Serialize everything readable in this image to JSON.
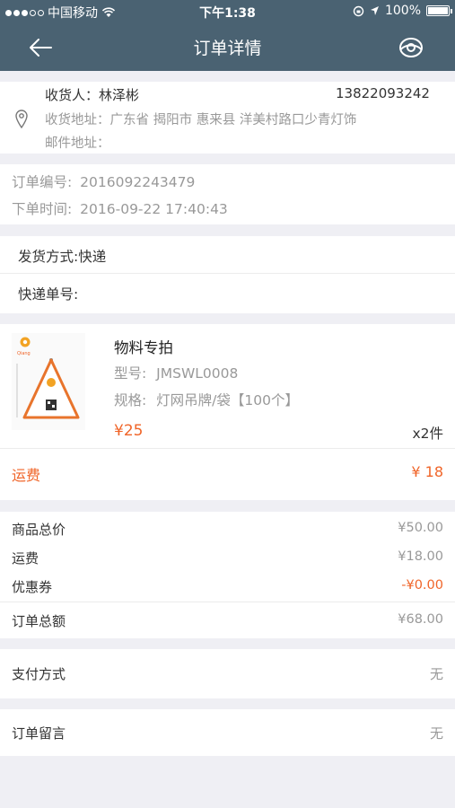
{
  "status_bar": {
    "carrier": "中国移动",
    "time": "下午1:38",
    "battery": "100%",
    "signal_filled": 3,
    "signal_total": 5
  },
  "nav": {
    "title": "订单详情",
    "back_icon": "arrow-left-icon",
    "right_icon": "eye-icon"
  },
  "address": {
    "receiver_label": "收货人：",
    "receiver_name": "林泽彬",
    "phone": "13822093242",
    "address_label": "收货地址：",
    "address_value": "广东省 揭阳市 惠来县  洋美村路口少青灯饰",
    "postal_label": "邮件地址：",
    "postal_value": ""
  },
  "order": {
    "number_label": "订单编号:",
    "number_value": "2016092243479",
    "time_label": "下单时间:",
    "time_value": "2016-09-22 17:40:43"
  },
  "shipping": {
    "method_label": "发货方式:",
    "method_value": "快递",
    "tracking_label": "快递单号:",
    "tracking_value": ""
  },
  "product": {
    "name": "物料专拍",
    "model_label": "型号:",
    "model_value": "JMSWL0008",
    "spec_label": "规格:",
    "spec_value": "灯网吊牌/袋【100个】",
    "price": "¥25",
    "quantity": "x2件",
    "freight_label": "运费",
    "freight_value": "¥ 18",
    "image_brand": "Qiang"
  },
  "summary": {
    "rows": [
      {
        "label": "商品总价",
        "value": "¥50.00"
      },
      {
        "label": "运费",
        "value": "¥18.00"
      },
      {
        "label": "优惠券",
        "value": "-¥0.00"
      }
    ],
    "total_label": "订单总额",
    "total_value": "¥68.00"
  },
  "payment": {
    "label": "支付方式",
    "value": "无"
  },
  "remark": {
    "label": "订单留言",
    "value": "无"
  },
  "colors": {
    "header": "#4a6272",
    "accent": "#f06529",
    "background": "#efeff4"
  }
}
